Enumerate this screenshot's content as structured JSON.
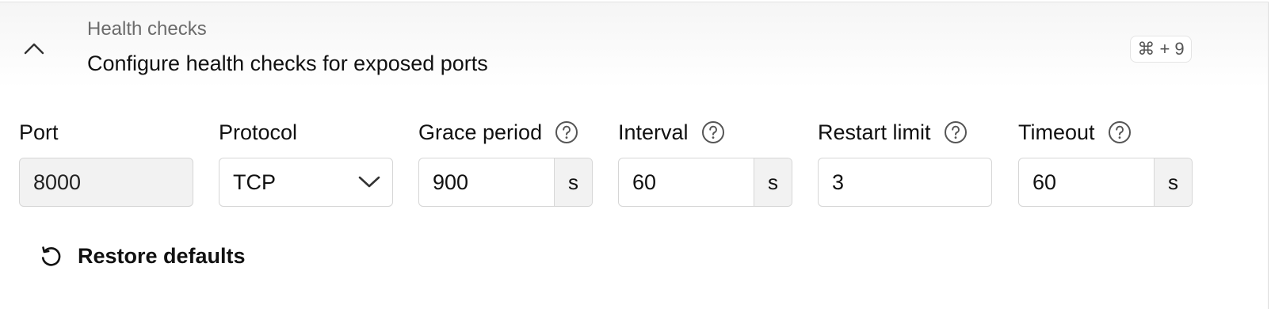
{
  "section": {
    "eyebrow": "Health checks",
    "title": "Configure health checks for exposed ports",
    "shortcut": "⌘ + 9",
    "collapse_icon": "chevron-up-icon"
  },
  "fields": {
    "port": {
      "label": "Port",
      "value": "8000"
    },
    "protocol": {
      "label": "Protocol",
      "value": "TCP"
    },
    "grace_period": {
      "label": "Grace period",
      "value": "900",
      "unit": "s"
    },
    "interval": {
      "label": "Interval",
      "value": "60",
      "unit": "s"
    },
    "restart_limit": {
      "label": "Restart limit",
      "value": "3"
    },
    "timeout": {
      "label": "Timeout",
      "value": "60",
      "unit": "s"
    }
  },
  "actions": {
    "restore_label": "Restore defaults",
    "restore_icon": "restore-icon"
  },
  "colors": {
    "border": "#d6d6d6",
    "readonly_bg": "#f2f2f2",
    "help_icon": "#555555"
  }
}
